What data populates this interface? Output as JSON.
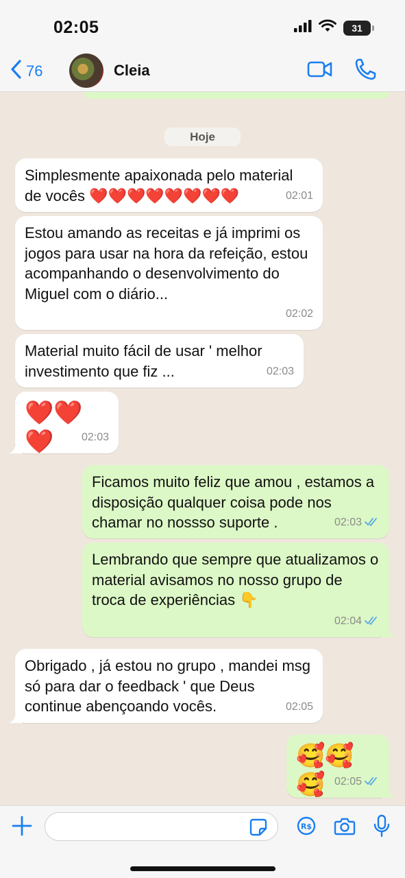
{
  "status_bar": {
    "time": "02:05",
    "battery": "31"
  },
  "header": {
    "back_count": "76",
    "contact_name": "Cleia"
  },
  "date_separator": "Hoje",
  "messages": [
    {
      "direction": "in",
      "text": "Simplesmente apaixonada pelo material de vocês ❤️❤️❤️❤️❤️❤️❤️❤️",
      "time": "02:01"
    },
    {
      "direction": "in",
      "text": "Estou amando as receitas e já imprimi os jogos para usar na hora da refeição, estou acompanhando o desenvolvimento do Miguel com o diário...",
      "time": "02:02"
    },
    {
      "direction": "in",
      "text": "Material muito fácil de usar ' melhor investimento que fiz ...",
      "time": "02:03"
    },
    {
      "direction": "in",
      "text": "❤️❤️❤️",
      "time": "02:03"
    },
    {
      "direction": "out",
      "text": "Ficamos muito feliz que amou , estamos a disposição qualquer coisa pode nos chamar no nossso suporte .",
      "time": "02:03",
      "status": "read"
    },
    {
      "direction": "out",
      "text": "Lembrando que sempre que atualizamos o material avisamos no nosso grupo de troca de experiências 👇",
      "time": "02:04",
      "status": "read"
    },
    {
      "direction": "in",
      "text": "Obrigado , já estou no grupo , mandei msg só para dar o feedback ' que Deus continue abençoando vocês.",
      "time": "02:05"
    },
    {
      "direction": "out",
      "text": "🥰🥰🥰",
      "time": "02:05",
      "status": "read"
    }
  ],
  "input": {
    "placeholder": ""
  },
  "icons": {
    "back": "chevron-left-icon",
    "video": "video-camera-icon",
    "call": "phone-icon",
    "add": "plus-icon",
    "sticker": "sticker-icon",
    "payment": "pix-real-icon",
    "camera": "camera-icon",
    "mic": "microphone-icon",
    "read_receipt": "double-check-icon"
  },
  "colors": {
    "accent": "#1a7ef0",
    "incoming_bubble": "#ffffff",
    "outgoing_bubble": "#dcf8c6",
    "chat_background": "#efe7de",
    "read_check": "#53a6e8"
  }
}
